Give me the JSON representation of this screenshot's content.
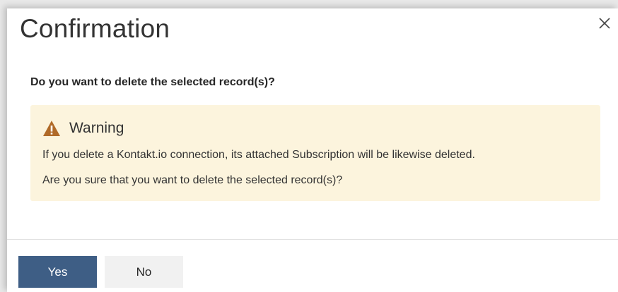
{
  "dialog": {
    "title": "Confirmation",
    "question": "Do you want to delete the selected record(s)?",
    "close_icon": "close-icon"
  },
  "warning": {
    "icon": "warning-triangle-icon",
    "title": "Warning",
    "message_1": "If you delete a Kontakt.io connection, its attached Subscription will be likewise deleted.",
    "message_2": "Are you sure that you want to delete the selected record(s)?"
  },
  "buttons": {
    "yes_label": "Yes",
    "no_label": "No"
  },
  "colors": {
    "primary_button": "#3e5e85",
    "secondary_button": "#f1f1f1",
    "warning_background": "#fcf4dd",
    "warning_icon": "#b06a28"
  }
}
